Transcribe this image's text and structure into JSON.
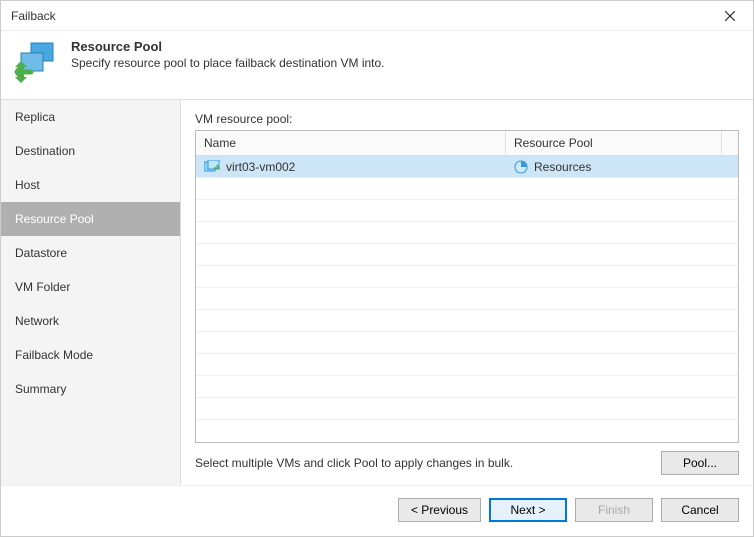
{
  "window": {
    "title": "Failback"
  },
  "header": {
    "title": "Resource Pool",
    "subtitle": "Specify resource pool to place failback destination VM into."
  },
  "sidebar": {
    "items": [
      {
        "label": "Replica"
      },
      {
        "label": "Destination"
      },
      {
        "label": "Host"
      },
      {
        "label": "Resource Pool"
      },
      {
        "label": "Datastore"
      },
      {
        "label": "VM Folder"
      },
      {
        "label": "Network"
      },
      {
        "label": "Failback Mode"
      },
      {
        "label": "Summary"
      }
    ],
    "active_index": 3
  },
  "main": {
    "label": "VM resource pool:",
    "columns": {
      "name": "Name",
      "pool": "Resource Pool"
    },
    "rows": [
      {
        "name": "virt03-vm002",
        "pool": "Resources"
      }
    ],
    "hint": "Select multiple VMs and click Pool to apply changes in bulk.",
    "pool_button": "Pool..."
  },
  "footer": {
    "previous": "< Previous",
    "next": "Next >",
    "finish": "Finish",
    "cancel": "Cancel"
  }
}
